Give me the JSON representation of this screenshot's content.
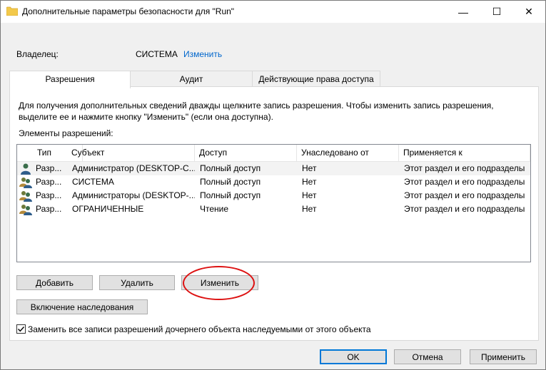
{
  "window": {
    "title": "Дополнительные параметры безопасности  для \"Run\"",
    "minimize_glyph": "—",
    "maximize_glyph": "☐",
    "close_glyph": "✕"
  },
  "owner": {
    "label": "Владелец:",
    "value": "СИСТЕМА",
    "change_link": "Изменить"
  },
  "tabs": [
    {
      "label": "Разрешения",
      "active": true
    },
    {
      "label": "Аудит",
      "active": false
    },
    {
      "label": "Действующие права доступа",
      "active": false
    }
  ],
  "panel": {
    "hint": "Для получения дополнительных сведений дважды щелкните запись разрешения. Чтобы изменить запись разрешения, выделите ее и нажмите кнопку \"Изменить\" (если она доступна).",
    "entries_label": "Элементы разрешений:"
  },
  "table": {
    "columns": [
      "Тип",
      "Субъект",
      "Доступ",
      "Унаследовано от",
      "Применяется к"
    ],
    "rows": [
      {
        "type": "Разр...",
        "subject": "Администратор (DESKTOP-C...",
        "access": "Полный доступ",
        "inherited": "Нет",
        "applies": "Этот раздел и его подразделы",
        "icon": "single-user-icon"
      },
      {
        "type": "Разр...",
        "subject": "СИСТЕМА",
        "access": "Полный доступ",
        "inherited": "Нет",
        "applies": "Этот раздел и его подразделы",
        "icon": "users-group-icon"
      },
      {
        "type": "Разр...",
        "subject": "Администраторы (DESKTOP-...",
        "access": "Полный доступ",
        "inherited": "Нет",
        "applies": "Этот раздел и его подразделы",
        "icon": "users-group-icon"
      },
      {
        "type": "Разр...",
        "subject": "ОГРАНИЧЕННЫЕ",
        "access": "Чтение",
        "inherited": "Нет",
        "applies": "Этот раздел и его подразделы",
        "icon": "users-group-icon"
      }
    ]
  },
  "buttons": {
    "add": "Добавить",
    "remove": "Удалить",
    "edit": "Изменить",
    "inheritance": "Включение наследования",
    "ok": "OK",
    "cancel": "Отмена",
    "apply": "Применить"
  },
  "replace_checkbox": {
    "label": "Заменить все записи разрешений дочернего объекта наследуемыми от этого объекта",
    "checked": true
  },
  "colors": {
    "accent": "#0078d7",
    "link": "#0066cc",
    "callout": "#dd1111"
  }
}
